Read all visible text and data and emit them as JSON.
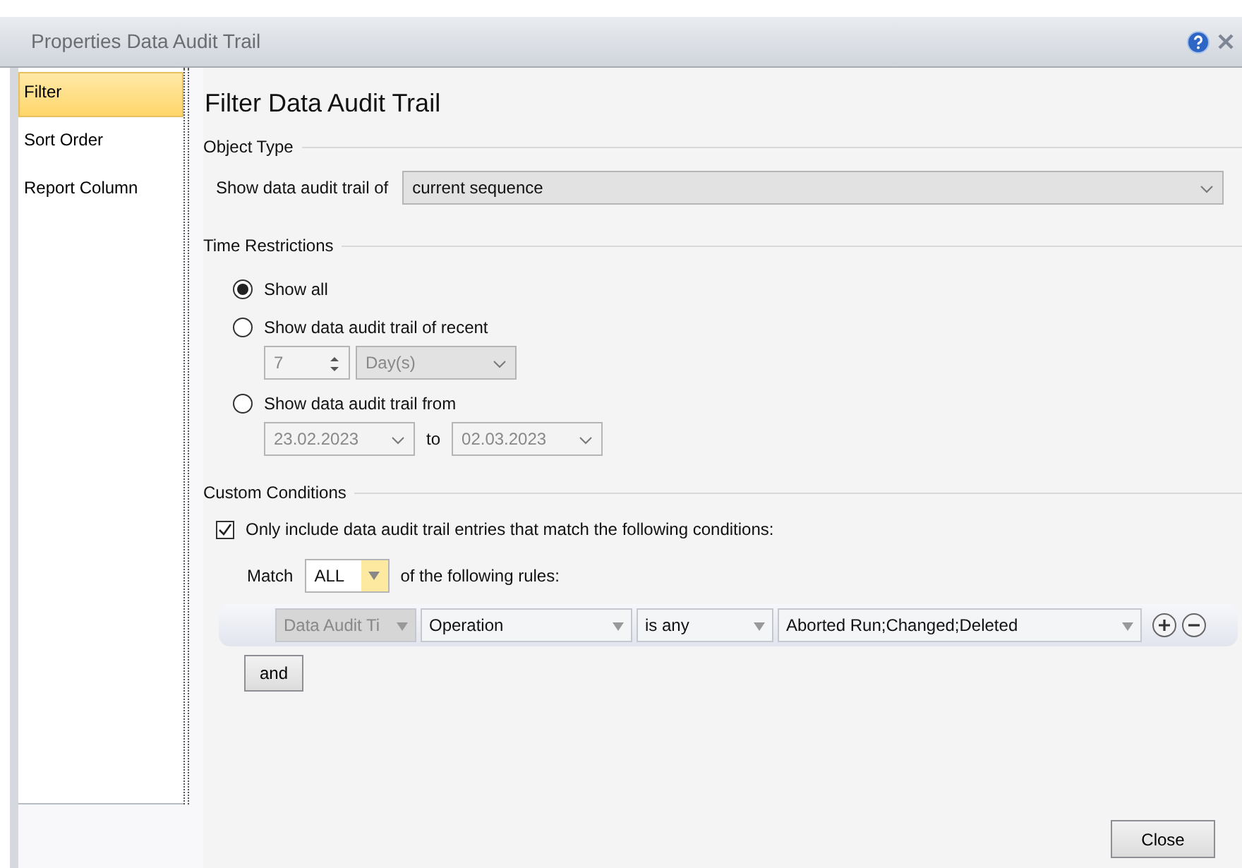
{
  "window": {
    "title": "Properties Data Audit Trail"
  },
  "sidebar": {
    "items": [
      {
        "label": "Filter",
        "selected": true
      },
      {
        "label": "Sort Order",
        "selected": false
      },
      {
        "label": "Report Column",
        "selected": false
      }
    ]
  },
  "heading": "Filter Data Audit Trail",
  "object_type": {
    "title": "Object Type",
    "label": "Show data audit trail of",
    "value": "current sequence"
  },
  "time_restrictions": {
    "title": "Time Restrictions",
    "options": [
      {
        "label": "Show all",
        "selected": true,
        "kind": "plain"
      },
      {
        "label": "Show data audit trail of recent",
        "selected": false,
        "kind": "recent"
      },
      {
        "label": "Show data audit trail from",
        "selected": false,
        "kind": "range"
      }
    ],
    "recent": {
      "number": "7",
      "unit": "Day(s)",
      "disabled": true
    },
    "range": {
      "from": "23.02.2023",
      "to_label": "to",
      "to": "02.03.2023",
      "disabled": true
    }
  },
  "custom_conditions": {
    "title": "Custom Conditions",
    "checked": true,
    "label": "Only include data audit trail entries that match the following conditions:",
    "match": {
      "label": "Match",
      "value": "ALL",
      "suffix": "of the following rules:"
    },
    "rules": [
      {
        "group": "Data Audit Ti",
        "field": "Operation",
        "operator": "is any",
        "value": "Aborted Run;Changed;Deleted"
      }
    ],
    "and_button": "and"
  },
  "buttons": [
    "Close"
  ]
}
